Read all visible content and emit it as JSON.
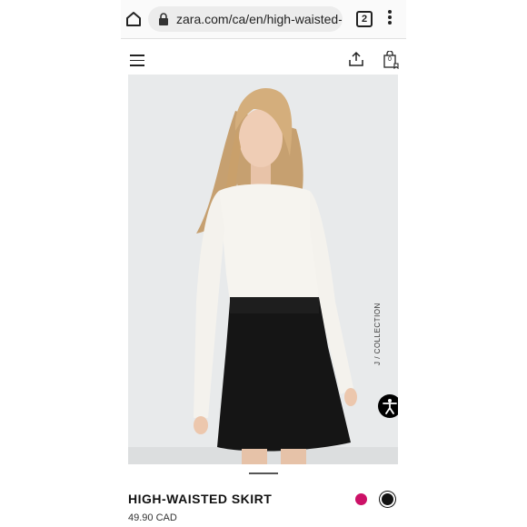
{
  "browser": {
    "url": "zara.com/ca/en/high-waisted-s",
    "tab_count": "2"
  },
  "header": {
    "bag_count": "0"
  },
  "product": {
    "collection_text": "J / COLLECTION",
    "name": "HIGH-WAISTED SKIRT",
    "price": "49.90 CAD",
    "colors": [
      {
        "name": "pink",
        "hex": "#cc1167"
      },
      {
        "name": "black",
        "hex": "#111111",
        "selected": true
      }
    ]
  }
}
